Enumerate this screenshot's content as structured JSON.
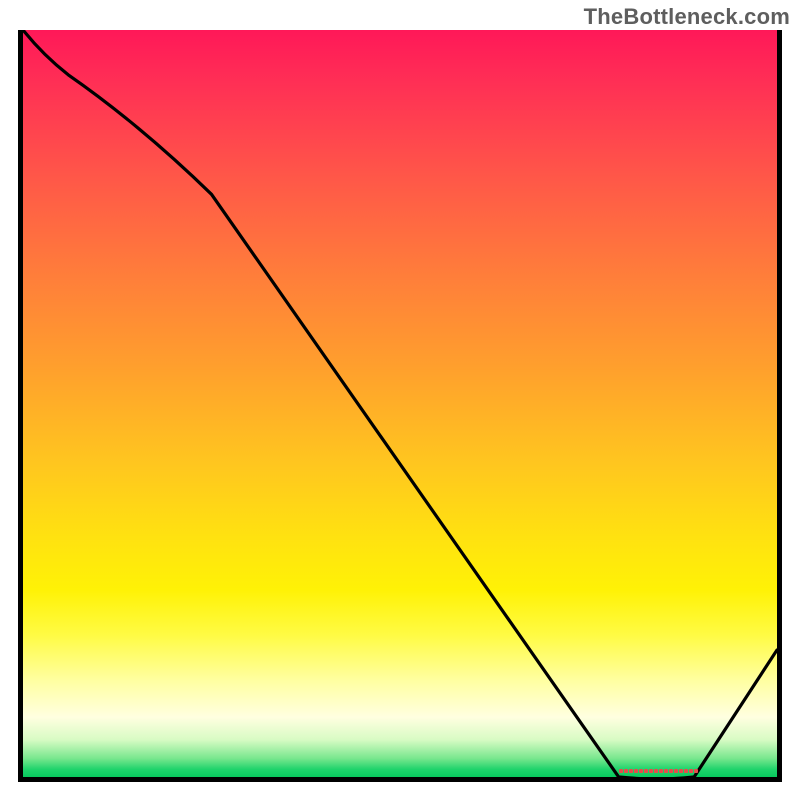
{
  "attribution": "TheBottleneck.com",
  "chart_data": {
    "type": "line",
    "title": "",
    "xlabel": "",
    "ylabel": "",
    "xlim": [
      0,
      100
    ],
    "ylim": [
      0,
      100
    ],
    "x": [
      0,
      6,
      25,
      79,
      89,
      100
    ],
    "values": [
      100,
      94,
      78,
      0,
      0,
      17
    ],
    "colors": {
      "curve": "#000000",
      "gradient_top": "#ff1858",
      "gradient_mid": "#fff206",
      "gradient_bottom": "#07c95d",
      "marker": "#e64b4b"
    },
    "marker": {
      "x_start": 79,
      "x_end": 89,
      "y": 0
    },
    "grid": false,
    "legend": false
  }
}
